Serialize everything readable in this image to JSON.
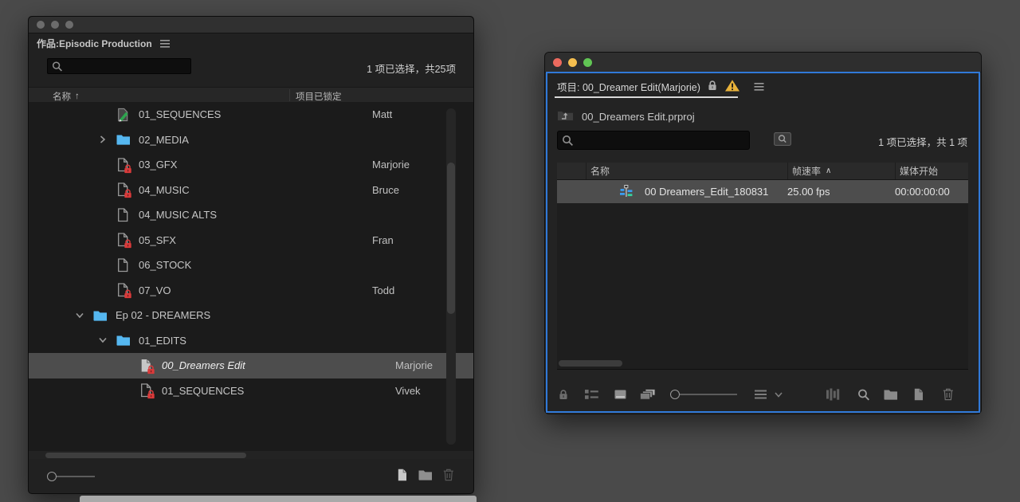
{
  "colors": {
    "desktop_bg": "#4a4a4a",
    "focus_border_blue": "#3079d8",
    "lock_red": "#d93a3a",
    "folder_blue": "#55b7f0",
    "pencil_green": "#2da44e",
    "label_purple": "#ae9ee6",
    "warning_yellow": "#e8b23a",
    "selected_row": "#4d4d4d",
    "active_view_blue": "#3b9df0"
  },
  "left_window": {
    "title": "作品:Episodic Production",
    "summary": "1 项已选择，共25项",
    "search": {
      "value": ""
    },
    "columns": {
      "name": "名称",
      "sort_indicator": "↑",
      "locked": "项目已锁定"
    },
    "rows": [
      {
        "name": "01_SEQUENCES",
        "locked_by": "Matt",
        "icon": "doc-pencil-icon"
      },
      {
        "name": "02_MEDIA",
        "locked_by": "",
        "icon": "folder-icon"
      },
      {
        "name": "03_GFX",
        "locked_by": "Marjorie",
        "icon": "doc-lock-icon"
      },
      {
        "name": "04_MUSIC",
        "locked_by": "Bruce",
        "icon": "doc-lock-icon"
      },
      {
        "name": "04_MUSIC ALTS",
        "locked_by": "",
        "icon": "doc-icon"
      },
      {
        "name": "05_SFX",
        "locked_by": "Fran",
        "icon": "doc-lock-icon"
      },
      {
        "name": "06_STOCK",
        "locked_by": "",
        "icon": "doc-icon"
      },
      {
        "name": "07_VO",
        "locked_by": "Todd",
        "icon": "doc-lock-icon"
      },
      {
        "name": "Ep 02 - DREAMERS",
        "locked_by": "",
        "icon": "folder-icon"
      },
      {
        "name": "01_EDITS",
        "locked_by": "",
        "icon": "folder-icon"
      },
      {
        "name": "00_Dreamers Edit",
        "locked_by": "Marjorie",
        "icon": "doc-lock-filled-icon"
      },
      {
        "name": "01_SEQUENCES",
        "locked_by": "Vivek",
        "icon": "doc-lock-icon"
      }
    ]
  },
  "right_window": {
    "tab_title": "项目: 00_Dreamer Edit(Marjorie)",
    "breadcrumb": "00_Dreamers Edit.prproj",
    "summary": "1 项已选择，共 1 项",
    "search": {
      "value": ""
    },
    "columns": {
      "name": "名称",
      "frame_rate": "帧速率",
      "sort_indicator": "∧",
      "media_start": "媒体开始"
    },
    "rows": [
      {
        "name": "00 Dreamers_Edit_180831",
        "frame_rate": "25.00 fps",
        "media_start": "00:00:00:00",
        "label_color": "#ae9ee6"
      }
    ]
  }
}
